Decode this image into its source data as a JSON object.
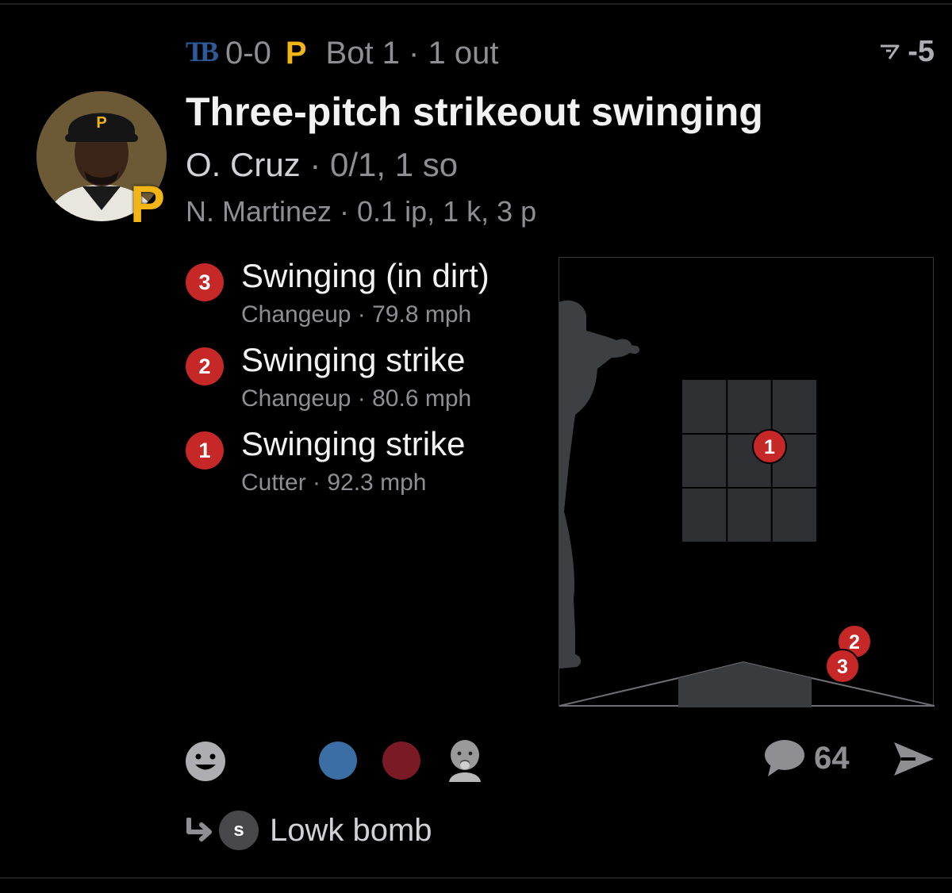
{
  "header": {
    "away_team_abbr": "TB",
    "score": "0-0",
    "home_team_letter": "P",
    "inning_text": "Bot 1 · 1 out",
    "delta_value": "-5",
    "delta_icon": "delta-arrow-icon"
  },
  "play": {
    "title": "Three-pitch strikeout swinging",
    "batter_name": "O. Cruz",
    "batter_stats": " · 0/1, 1 so",
    "pitcher_line": "N. Martinez · 0.1 ip, 1 k, 3 p",
    "avatar_icon": "player-avatar-icon",
    "team_badge": "P"
  },
  "pitches": [
    {
      "number": "3",
      "result": "Swinging (in dirt)",
      "detail": "Changeup ·  79.8 mph"
    },
    {
      "number": "2",
      "result": "Swinging strike",
      "detail": "Changeup ·  80.6 mph"
    },
    {
      "number": "1",
      "result": "Swinging strike",
      "detail": "Cutter ·  92.3 mph"
    }
  ],
  "zone": {
    "markers": [
      "1",
      "2",
      "3"
    ],
    "marker_color": "#c62828"
  },
  "actions": {
    "reaction_dot_colors": [
      "#3a6ea5",
      "#7a1a24"
    ],
    "comment_count": "64",
    "icons": [
      "emoji-icon",
      "comment-icon",
      "send-icon"
    ]
  },
  "reply": {
    "avatar_letter": "s",
    "text": "Lowk bomb"
  }
}
